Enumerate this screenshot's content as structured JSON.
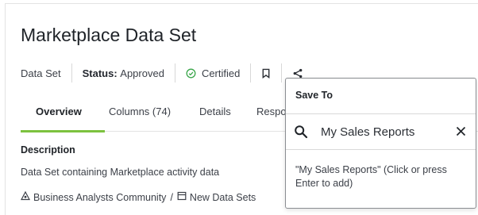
{
  "header": {
    "title": "Marketplace Data Set"
  },
  "meta": {
    "type": "Data Set",
    "status_label": "Status:",
    "status_value": "Approved",
    "certified": "Certified",
    "certified_color": "#3aa64a"
  },
  "tabs": [
    {
      "label": "Overview",
      "active": true
    },
    {
      "label": "Columns (74)"
    },
    {
      "label": "Details"
    },
    {
      "label": "Respo"
    }
  ],
  "tab_accent": "#7cc23f",
  "description": {
    "heading": "Description",
    "text": "Data Set containing Marketplace activity data"
  },
  "breadcrumb": {
    "community": "Business Analysts Community",
    "separator": "/",
    "folder": "New Data Sets"
  },
  "save_popover": {
    "title": "Save To",
    "search_value": "My Sales Reports",
    "suggestion": "\"My Sales Reports\" (Click or press Enter to add)"
  },
  "icons": [
    "check-circle-icon",
    "bookmark-icon",
    "share-icon",
    "community-icon",
    "folder-icon",
    "search-icon",
    "close-icon"
  ]
}
